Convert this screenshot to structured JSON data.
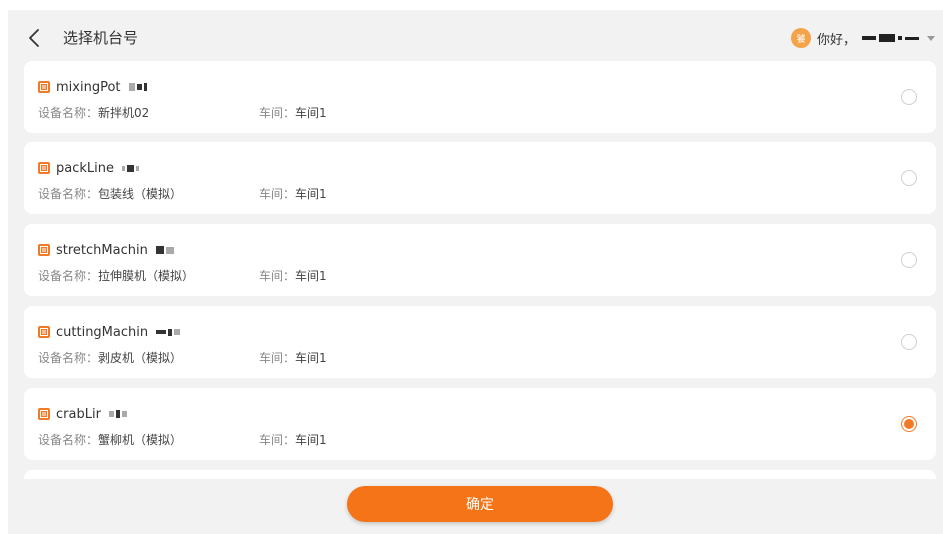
{
  "header": {
    "title": "选择机台号",
    "greeting": "你好，",
    "avatar_text": "饕",
    "back_icon": "chevron-left-icon"
  },
  "colors": {
    "accent": "#f57418",
    "background": "#f2f2f2",
    "card": "#ffffff"
  },
  "devices": [
    {
      "code": "mixingPot",
      "name_label": "设备名称：",
      "name": "新拌机02",
      "workshop_label": "车间：",
      "workshop": "车间1",
      "selected": false
    },
    {
      "code": "packLine",
      "name_label": "设备名称：",
      "name": "包装线（模拟）",
      "workshop_label": "车间：",
      "workshop": "车间1",
      "selected": false
    },
    {
      "code": "stretchMachin",
      "name_label": "设备名称：",
      "name": "拉伸膜机（模拟）",
      "workshop_label": "车间：",
      "workshop": "车间1",
      "selected": false
    },
    {
      "code": "cuttingMachin",
      "name_label": "设备名称：",
      "name": "剥皮机（模拟）",
      "workshop_label": "车间：",
      "workshop": "车间1",
      "selected": false
    },
    {
      "code": "crabLir",
      "name_label": "设备名称：",
      "name": "蟹柳机（模拟）",
      "workshop_label": "车间：",
      "workshop": "车间1",
      "selected": true
    }
  ],
  "footer": {
    "confirm_label": "确定"
  }
}
